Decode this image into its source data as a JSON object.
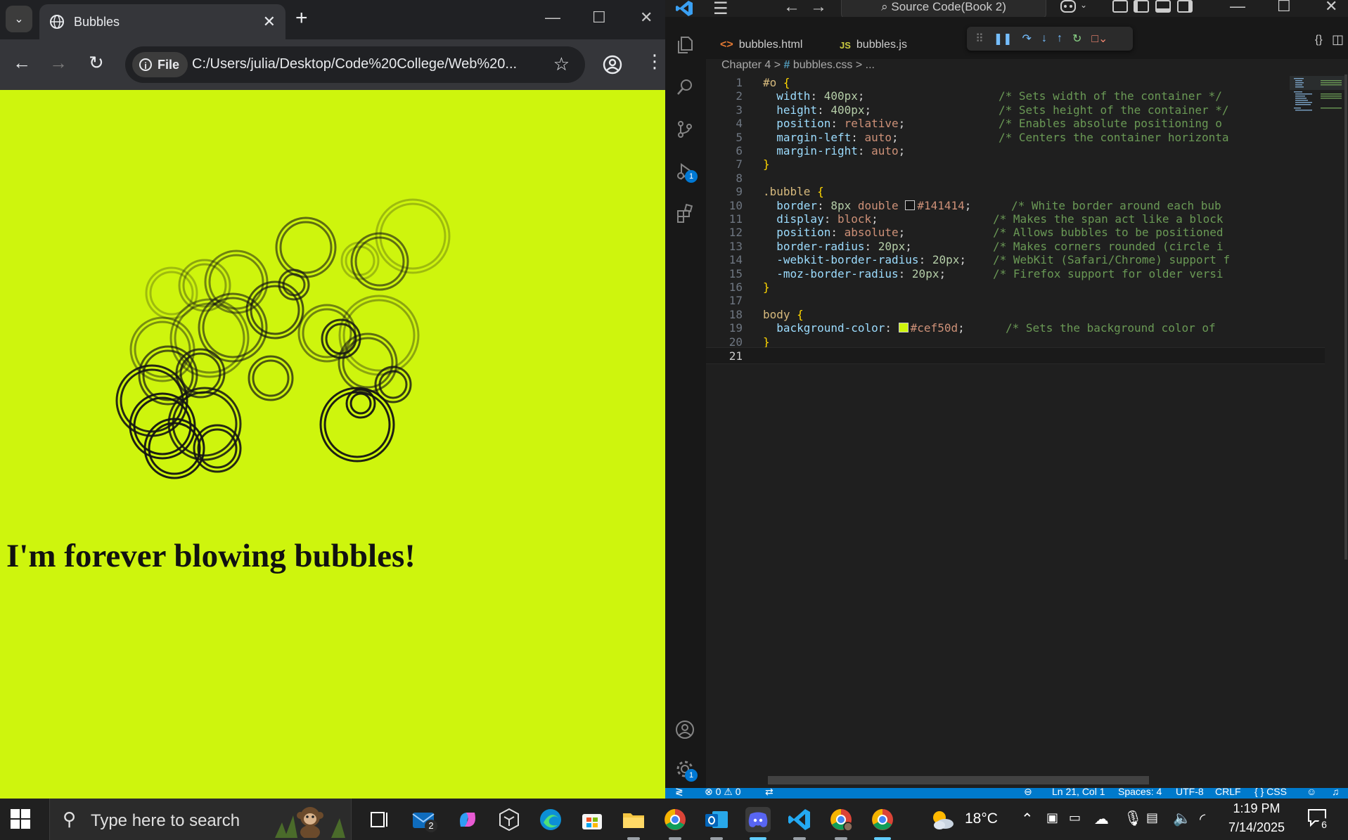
{
  "browser": {
    "tab_title": "Bubbles",
    "file_chip": "File",
    "url": "C:/Users/julia/Desktop/Code%20College/Web%20...",
    "page": {
      "heading": "I'm forever blowing bubbles!",
      "background_color": "#cef50d"
    }
  },
  "vscode": {
    "command_center": "Source Code(Book 2)",
    "tabs": [
      {
        "label": "bubbles.html",
        "icon": "html-icon"
      },
      {
        "label": "bubbles.js",
        "icon_text": "JS"
      }
    ],
    "breadcrumb": {
      "folder": "Chapter 4",
      "sep1": ">",
      "file": "bubbles.css",
      "sep2": "> ..."
    },
    "activity_badges": {
      "run_debug": "1",
      "settings": "1"
    },
    "code_lines": [
      {
        "n": "1",
        "t": "#o {"
      },
      {
        "n": "2",
        "t": "  width: 400px;",
        "c": "/* Sets width of the container */"
      },
      {
        "n": "3",
        "t": "  height: 400px;",
        "c": "/* Sets height of the container */"
      },
      {
        "n": "4",
        "t": "  position: relative;",
        "c": "/* Enables absolute positioning o"
      },
      {
        "n": "5",
        "t": "  margin-left: auto;",
        "c": "/* Centers the container horizonta"
      },
      {
        "n": "6",
        "t": "  margin-right: auto;"
      },
      {
        "n": "7",
        "t": "}"
      },
      {
        "n": "8",
        "t": ""
      },
      {
        "n": "9",
        "t": ".bubble {"
      },
      {
        "n": "10",
        "t": "  border: 8px double #141414;",
        "c": "/* White border around each bub"
      },
      {
        "n": "11",
        "t": "  display: block;",
        "c": "/* Makes the span act like a block"
      },
      {
        "n": "12",
        "t": "  position: absolute;",
        "c": "/* Allows bubbles to be positioned"
      },
      {
        "n": "13",
        "t": "  border-radius: 20px;",
        "c": "/* Makes corners rounded (circle i"
      },
      {
        "n": "14",
        "t": "  -webkit-border-radius: 20px;",
        "c": "/* WebKit (Safari/Chrome) support f"
      },
      {
        "n": "15",
        "t": "  -moz-border-radius: 20px;",
        "c": "/* Firefox support for older versi"
      },
      {
        "n": "16",
        "t": "}"
      },
      {
        "n": "17",
        "t": ""
      },
      {
        "n": "18",
        "t": "body {"
      },
      {
        "n": "19",
        "t": "  background-color: #cef50d;",
        "c": "/* Sets the background color of"
      },
      {
        "n": "20",
        "t": "}"
      },
      {
        "n": "21",
        "t": ""
      }
    ],
    "status_bar": {
      "problems": "⊗ 0 ⚠ 0",
      "position": "Ln 21, Col 1",
      "spaces": "Spaces: 4",
      "encoding": "UTF-8",
      "eol": "CRLF",
      "language": "{ } CSS"
    }
  },
  "taskbar": {
    "search_placeholder": "Type here to search",
    "mail_badge": "2",
    "weather_temp": "18°C",
    "time": "1:19 PM",
    "date": "7/14/2025",
    "notification_count": "6",
    "apps": [
      "task-view",
      "mail",
      "copilot",
      "dev-tool",
      "edge",
      "store",
      "file-explorer",
      "chrome",
      "outlook",
      "discord",
      "vscode",
      "chrome-profile",
      "chrome"
    ]
  },
  "colors": {
    "page_bg": "#cef50d",
    "bubble_border": "#141414",
    "vscode_accent": "#007acc",
    "chrome_frame": "#202124"
  }
}
